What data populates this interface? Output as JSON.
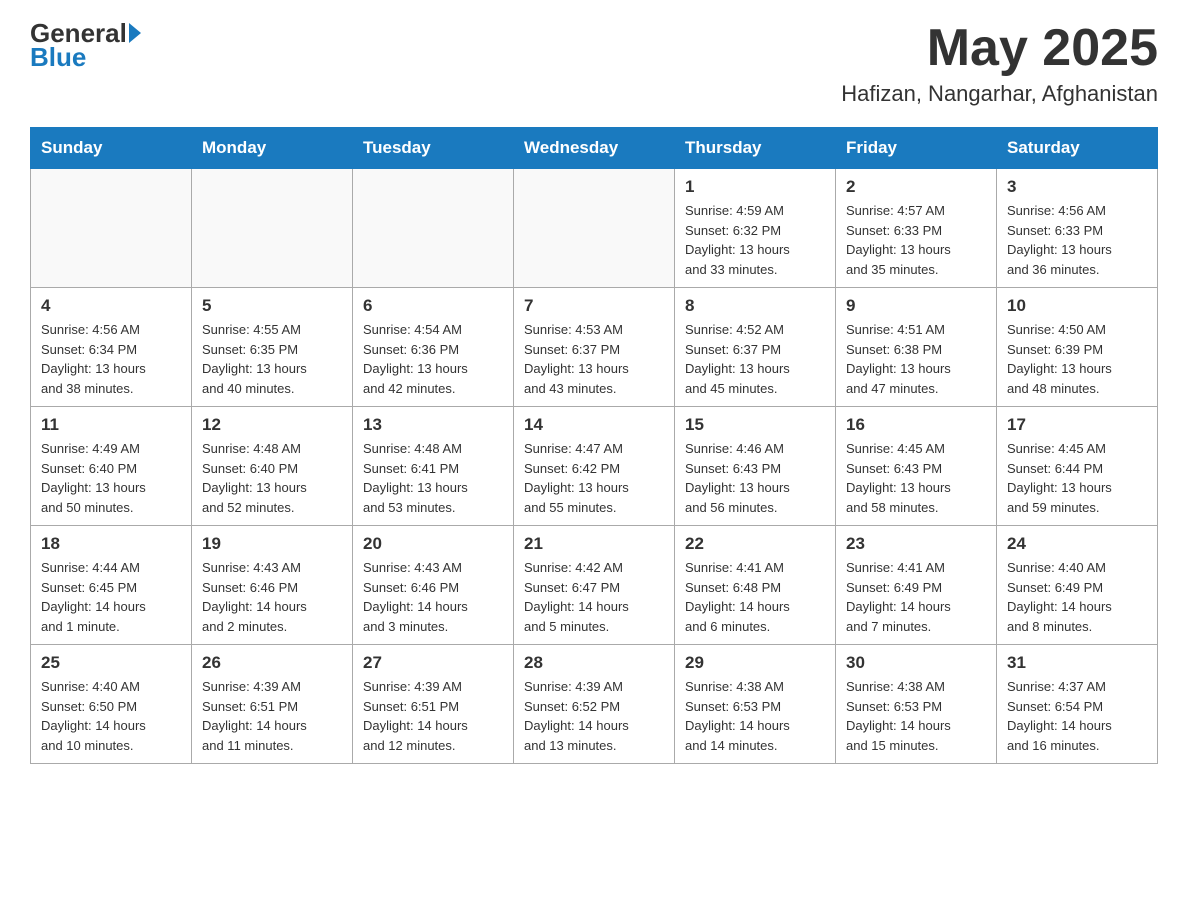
{
  "header": {
    "logo_general": "General",
    "logo_blue": "Blue",
    "month_title": "May 2025",
    "location": "Hafizan, Nangarhar, Afghanistan"
  },
  "weekdays": [
    "Sunday",
    "Monday",
    "Tuesday",
    "Wednesday",
    "Thursday",
    "Friday",
    "Saturday"
  ],
  "weeks": [
    [
      {
        "day": "",
        "info": ""
      },
      {
        "day": "",
        "info": ""
      },
      {
        "day": "",
        "info": ""
      },
      {
        "day": "",
        "info": ""
      },
      {
        "day": "1",
        "info": "Sunrise: 4:59 AM\nSunset: 6:32 PM\nDaylight: 13 hours\nand 33 minutes."
      },
      {
        "day": "2",
        "info": "Sunrise: 4:57 AM\nSunset: 6:33 PM\nDaylight: 13 hours\nand 35 minutes."
      },
      {
        "day": "3",
        "info": "Sunrise: 4:56 AM\nSunset: 6:33 PM\nDaylight: 13 hours\nand 36 minutes."
      }
    ],
    [
      {
        "day": "4",
        "info": "Sunrise: 4:56 AM\nSunset: 6:34 PM\nDaylight: 13 hours\nand 38 minutes."
      },
      {
        "day": "5",
        "info": "Sunrise: 4:55 AM\nSunset: 6:35 PM\nDaylight: 13 hours\nand 40 minutes."
      },
      {
        "day": "6",
        "info": "Sunrise: 4:54 AM\nSunset: 6:36 PM\nDaylight: 13 hours\nand 42 minutes."
      },
      {
        "day": "7",
        "info": "Sunrise: 4:53 AM\nSunset: 6:37 PM\nDaylight: 13 hours\nand 43 minutes."
      },
      {
        "day": "8",
        "info": "Sunrise: 4:52 AM\nSunset: 6:37 PM\nDaylight: 13 hours\nand 45 minutes."
      },
      {
        "day": "9",
        "info": "Sunrise: 4:51 AM\nSunset: 6:38 PM\nDaylight: 13 hours\nand 47 minutes."
      },
      {
        "day": "10",
        "info": "Sunrise: 4:50 AM\nSunset: 6:39 PM\nDaylight: 13 hours\nand 48 minutes."
      }
    ],
    [
      {
        "day": "11",
        "info": "Sunrise: 4:49 AM\nSunset: 6:40 PM\nDaylight: 13 hours\nand 50 minutes."
      },
      {
        "day": "12",
        "info": "Sunrise: 4:48 AM\nSunset: 6:40 PM\nDaylight: 13 hours\nand 52 minutes."
      },
      {
        "day": "13",
        "info": "Sunrise: 4:48 AM\nSunset: 6:41 PM\nDaylight: 13 hours\nand 53 minutes."
      },
      {
        "day": "14",
        "info": "Sunrise: 4:47 AM\nSunset: 6:42 PM\nDaylight: 13 hours\nand 55 minutes."
      },
      {
        "day": "15",
        "info": "Sunrise: 4:46 AM\nSunset: 6:43 PM\nDaylight: 13 hours\nand 56 minutes."
      },
      {
        "day": "16",
        "info": "Sunrise: 4:45 AM\nSunset: 6:43 PM\nDaylight: 13 hours\nand 58 minutes."
      },
      {
        "day": "17",
        "info": "Sunrise: 4:45 AM\nSunset: 6:44 PM\nDaylight: 13 hours\nand 59 minutes."
      }
    ],
    [
      {
        "day": "18",
        "info": "Sunrise: 4:44 AM\nSunset: 6:45 PM\nDaylight: 14 hours\nand 1 minute."
      },
      {
        "day": "19",
        "info": "Sunrise: 4:43 AM\nSunset: 6:46 PM\nDaylight: 14 hours\nand 2 minutes."
      },
      {
        "day": "20",
        "info": "Sunrise: 4:43 AM\nSunset: 6:46 PM\nDaylight: 14 hours\nand 3 minutes."
      },
      {
        "day": "21",
        "info": "Sunrise: 4:42 AM\nSunset: 6:47 PM\nDaylight: 14 hours\nand 5 minutes."
      },
      {
        "day": "22",
        "info": "Sunrise: 4:41 AM\nSunset: 6:48 PM\nDaylight: 14 hours\nand 6 minutes."
      },
      {
        "day": "23",
        "info": "Sunrise: 4:41 AM\nSunset: 6:49 PM\nDaylight: 14 hours\nand 7 minutes."
      },
      {
        "day": "24",
        "info": "Sunrise: 4:40 AM\nSunset: 6:49 PM\nDaylight: 14 hours\nand 8 minutes."
      }
    ],
    [
      {
        "day": "25",
        "info": "Sunrise: 4:40 AM\nSunset: 6:50 PM\nDaylight: 14 hours\nand 10 minutes."
      },
      {
        "day": "26",
        "info": "Sunrise: 4:39 AM\nSunset: 6:51 PM\nDaylight: 14 hours\nand 11 minutes."
      },
      {
        "day": "27",
        "info": "Sunrise: 4:39 AM\nSunset: 6:51 PM\nDaylight: 14 hours\nand 12 minutes."
      },
      {
        "day": "28",
        "info": "Sunrise: 4:39 AM\nSunset: 6:52 PM\nDaylight: 14 hours\nand 13 minutes."
      },
      {
        "day": "29",
        "info": "Sunrise: 4:38 AM\nSunset: 6:53 PM\nDaylight: 14 hours\nand 14 minutes."
      },
      {
        "day": "30",
        "info": "Sunrise: 4:38 AM\nSunset: 6:53 PM\nDaylight: 14 hours\nand 15 minutes."
      },
      {
        "day": "31",
        "info": "Sunrise: 4:37 AM\nSunset: 6:54 PM\nDaylight: 14 hours\nand 16 minutes."
      }
    ]
  ]
}
